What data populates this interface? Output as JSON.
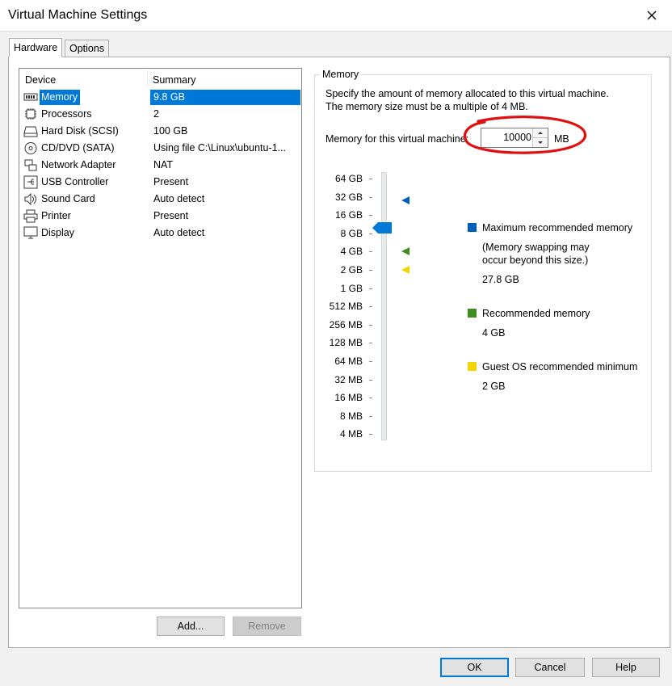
{
  "window": {
    "title": "Virtual Machine Settings"
  },
  "tabs": [
    {
      "label": "Hardware"
    },
    {
      "label": "Options"
    }
  ],
  "device_list": {
    "headers": {
      "device": "Device",
      "summary": "Summary"
    },
    "rows": [
      {
        "name": "Memory",
        "summary": "9.8 GB",
        "icon": "memory-icon"
      },
      {
        "name": "Processors",
        "summary": "2",
        "icon": "processor-icon"
      },
      {
        "name": "Hard Disk (SCSI)",
        "summary": "100 GB",
        "icon": "hard-disk-icon"
      },
      {
        "name": "CD/DVD (SATA)",
        "summary": "Using file C:\\Linux\\ubuntu-1...",
        "icon": "cd-dvd-icon"
      },
      {
        "name": "Network Adapter",
        "summary": "NAT",
        "icon": "network-adapter-icon"
      },
      {
        "name": "USB Controller",
        "summary": "Present",
        "icon": "usb-icon"
      },
      {
        "name": "Sound Card",
        "summary": "Auto detect",
        "icon": "speaker-icon"
      },
      {
        "name": "Printer",
        "summary": "Present",
        "icon": "printer-icon"
      },
      {
        "name": "Display",
        "summary": "Auto detect",
        "icon": "monitor-icon"
      }
    ],
    "selected": "Memory"
  },
  "list_buttons": {
    "add": "Add...",
    "remove": "Remove"
  },
  "memory": {
    "group_title": "Memory",
    "description_line1": "Specify the amount of memory allocated to this virtual machine.",
    "description_line2": "The memory size must be a multiple of 4 MB.",
    "field_label": "Memory for this virtual machine:",
    "field_value": "10000",
    "unit": "MB",
    "scale_labels": [
      "64 GB",
      "32 GB",
      "16 GB",
      "8 GB",
      "4 GB",
      "2 GB",
      "1 GB",
      "512 MB",
      "256 MB",
      "128 MB",
      "64 MB",
      "32 MB",
      "16 MB",
      "8 MB",
      "4 MB"
    ],
    "slider_value_mb": 10000,
    "legend": {
      "max": {
        "label": "Maximum recommended memory",
        "note_line1": "(Memory swapping may",
        "note_line2": "occur beyond this size.)",
        "value": "27.8 GB",
        "color": "#005fb8"
      },
      "recommended": {
        "label": "Recommended memory",
        "value": "4 GB",
        "color": "#3d8c1e"
      },
      "guest_min": {
        "label": "Guest OS recommended minimum",
        "value": "2 GB",
        "color": "#f2d600"
      }
    },
    "highlight_color": "#e01010"
  },
  "dialog_buttons": {
    "ok": "OK",
    "cancel": "Cancel",
    "help": "Help"
  }
}
